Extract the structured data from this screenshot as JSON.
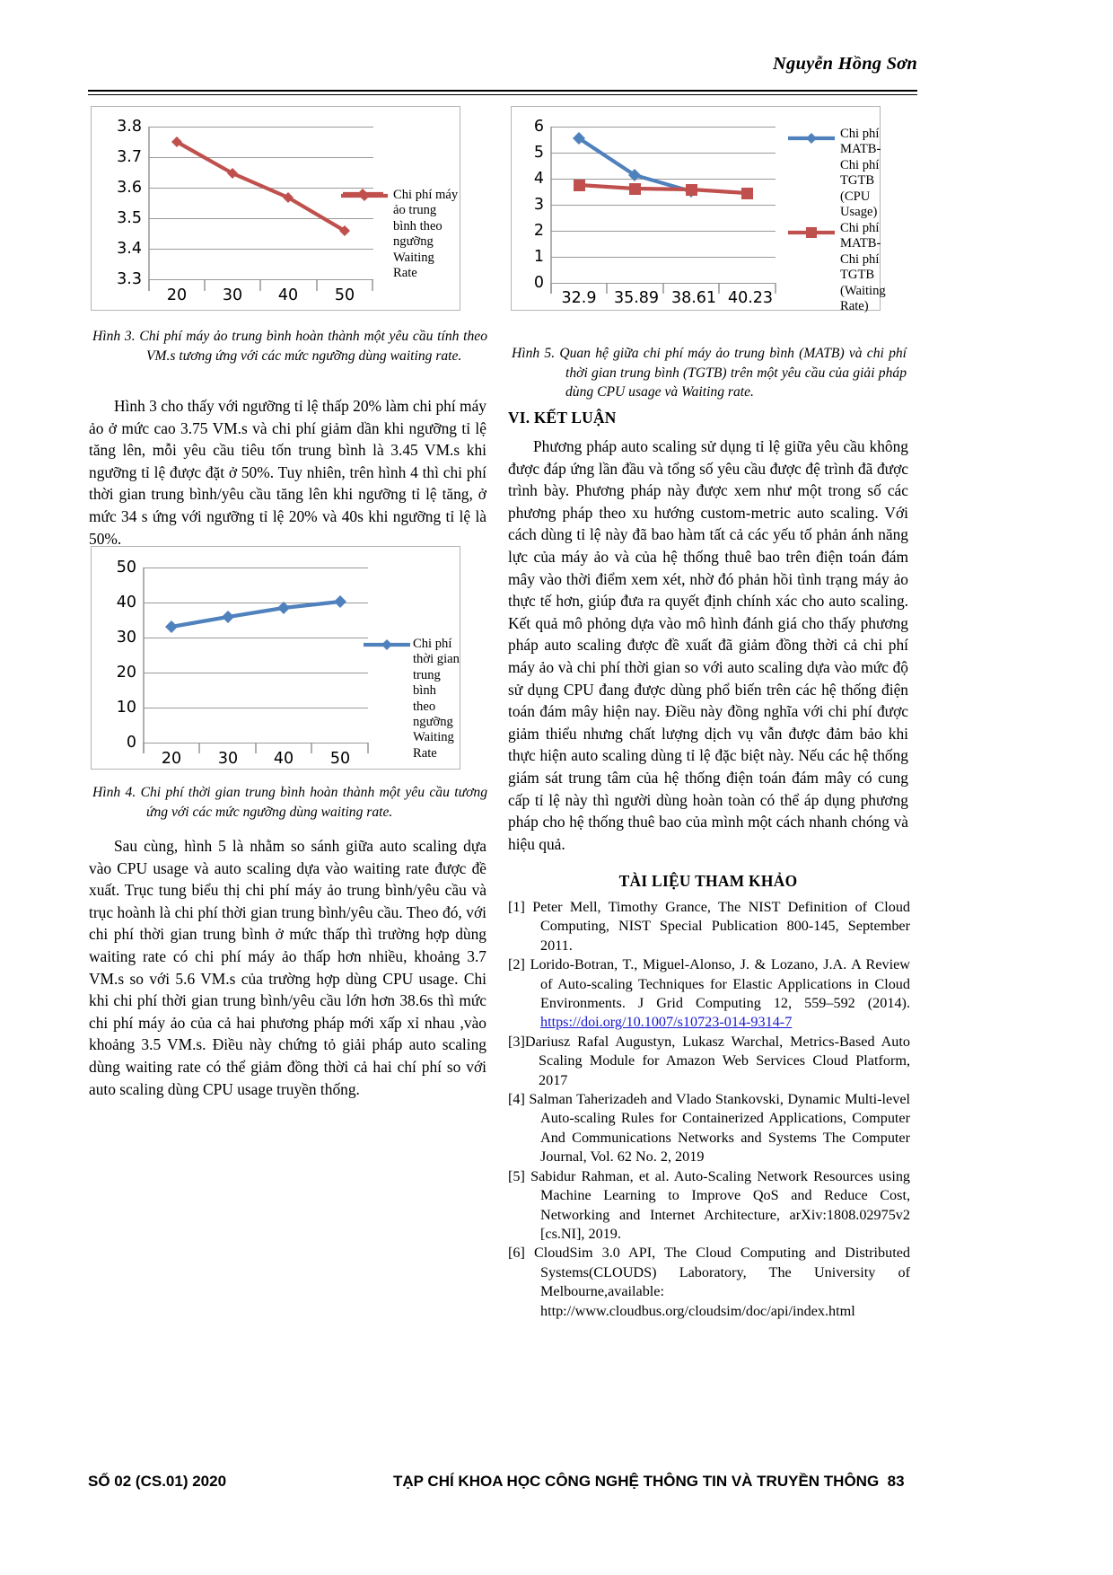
{
  "header": {
    "author": "Nguyễn Hồng Sơn"
  },
  "figure3": {
    "caption_label": "Hình 3.",
    "caption_text": "Chi phí máy ảo trung bình hoàn thành một yêu cầu tính theo VM.s tương ứng với các mức ngưỡng dùng waiting rate.",
    "legend": "Chi phí máy ảo trung bình theo ngưỡng Waiting Rate"
  },
  "figure4": {
    "caption_label": "Hình 4.",
    "caption_text": "Chi phí thời gian trung bình hoàn thành một yêu cầu tương ứng với các mức ngưỡng dùng waiting rate.",
    "legend": "Chi phí thời gian trung bình theo ngưỡng Waiting Rate"
  },
  "figure5": {
    "caption_label": "Hình 5.",
    "caption_text": "Quan hệ giữa chi phí máy ảo trung bình (MATB) và chi phí thời gian trung bình (TGTB) trên một yêu cầu của giải pháp dùng CPU usage và Waiting rate.",
    "legend1": "Chi phí MATB-Chi phí TGTB (CPU Usage)",
    "legend2": "Chi phí MATB-Chi phí TGTB (Waiting Rate)"
  },
  "chart_data": [
    {
      "id": "hinh3",
      "type": "line",
      "title": "",
      "xlabel": "",
      "ylabel": "",
      "categories": [
        "20",
        "30",
        "40",
        "50"
      ],
      "series": [
        {
          "name": "Chi phí máy ảo trung bình theo ngưỡng Waiting Rate",
          "color": "#C0504D",
          "marker": "diamond",
          "values": [
            3.75,
            3.645,
            3.565,
            3.455
          ]
        }
      ],
      "yticks": [
        "3.3",
        "3.4",
        "3.5",
        "3.6",
        "3.7",
        "3.8"
      ],
      "ylim": [
        3.3,
        3.8
      ],
      "grid": true,
      "legend_position": "right"
    },
    {
      "id": "hinh4",
      "type": "line",
      "title": "",
      "xlabel": "",
      "ylabel": "",
      "categories": [
        "20",
        "30",
        "40",
        "50"
      ],
      "series": [
        {
          "name": "Chi phí thời gian trung bình theo ngưỡng Waiting Rate",
          "color": "#4F81BD",
          "marker": "diamond",
          "values": [
            33,
            35.8,
            38.5,
            40.2
          ]
        }
      ],
      "yticks": [
        "0",
        "10",
        "20",
        "30",
        "40",
        "50"
      ],
      "ylim": [
        0,
        50
      ],
      "grid": true,
      "legend_position": "right"
    },
    {
      "id": "hinh5",
      "type": "line",
      "title": "",
      "xlabel": "",
      "ylabel": "",
      "categories": [
        "32.9",
        "35.89",
        "38.61",
        "40.23"
      ],
      "series": [
        {
          "name": "Chi phí MATB-Chi phí TGTB (CPU Usage)",
          "color": "#4F81BD",
          "marker": "diamond",
          "values": [
            5.55,
            4.15,
            3.52,
            null
          ]
        },
        {
          "name": "Chi phí MATB-Chi phí TGTB (Waiting Rate)",
          "color": "#C0504D",
          "marker": "square",
          "values": [
            3.75,
            3.63,
            3.57,
            3.45
          ]
        }
      ],
      "yticks": [
        "0",
        "1",
        "2",
        "3",
        "4",
        "5",
        "6"
      ],
      "ylim": [
        0,
        6
      ],
      "grid": true,
      "legend_position": "right"
    }
  ],
  "left_column": {
    "para1": "Hình 3 cho thấy với ngưỡng tỉ lệ thấp 20% làm chi phí máy ảo ở mức cao 3.75 VM.s và chi phí giảm dần khi ngưỡng tỉ lệ tăng lên, mỗi yêu cầu tiêu tốn trung bình là 3.45 VM.s khi ngưỡng tỉ lệ được đặt ở 50%. Tuy nhiên, trên hình 4 thì chi phí thời gian trung bình/yêu cầu tăng lên khi ngưỡng tỉ lệ tăng, ở mức 34 s ứng với ngưỡng tỉ lệ 20% và 40s khi ngưỡng tỉ lệ là 50%.",
    "para2": "Sau cùng, hình 5 là nhằm so sánh giữa auto scaling dựa vào CPU usage và auto scaling dựa vào waiting rate được đề xuất. Trục tung biểu thị chi phí máy ảo trung bình/yêu cầu và trục hoành là chi phí thời gian trung bình/yêu cầu. Theo đó, với chi phí thời gian trung bình ở mức thấp thì trường hợp dùng waiting rate có chi phí máy ảo thấp hơn nhiều, khoảng 3.7 VM.s so với 5.6 VM.s của trường hợp dùng CPU usage. Chi khi chi phí thời gian trung bình/yêu cầu lớn hơn 38.6s thì mức chi phí máy ảo của cả hai phương pháp mới xấp xỉ nhau ,vào khoảng 3.5 VM.s. Điều này chứng tỏ giải pháp auto scaling dùng waiting rate có thể giảm đồng thời cả hai chí phí so với auto scaling dùng CPU usage truyền thống."
  },
  "right_column": {
    "section_title": "VI. KẾT LUẬN",
    "para1": "Phương pháp auto scaling sử dụng tỉ lệ giữa yêu cầu không được đáp ứng lần đầu và tổng số yêu cầu được đệ trình đã được trình bày. Phương pháp này được xem như một trong số các phương pháp theo xu hướng custom-metric auto scaling. Với cách dùng tỉ lệ này đã bao hàm tất cả các yếu tố phản ánh năng lực của máy ảo và của hệ thống thuê bao trên điện toán đám mây vào thời điểm xem xét, nhờ đó phản hồi tình trạng máy ảo thực tế hơn, giúp đưa ra quyết định chính xác cho auto scaling. Kết quả mô phỏng dựa vào mô hình đánh giá cho thấy phương pháp auto scaling được đề xuất đã giảm đồng thời cả chi phí máy ảo và chi phí thời gian so với auto scaling dựa vào mức độ sử dụng CPU đang được dùng phổ biến trên các hệ thống điện toán đám mây hiện nay. Điều này đồng nghĩa với chi phí được giảm thiểu nhưng chất lượng dịch vụ vẫn được đảm bảo khi thực hiện auto scaling dùng tỉ lệ đặc biệt này. Nếu các hệ thống giám sát trung tâm của hệ thống điện toán đám mây có cung cấp tỉ lệ này thì người dùng hoàn toàn có thể áp dụng phương pháp cho hệ thống thuê bao của mình một cách nhanh chóng và hiệu quả.",
    "refs_title": "TÀI LIỆU THAM KHẢO"
  },
  "references": [
    {
      "num": "[1]",
      "text": "Peter Mell, Timothy Grance, The NIST Definition of Cloud Computing, NIST Special Publication 800-145, September 2011."
    },
    {
      "num": "[2]",
      "pre": "Lorido-Botran, T., Miguel-Alonso, J. & Lozano, J.A. A Review of Auto-scaling Techniques for Elastic Applications in Cloud Environments. J Grid Computing 12, 559–592 (2014). ",
      "link": "https://doi.org/10.1007/s10723-014-9314-7"
    },
    {
      "num": "[3]",
      "text": "Dariusz Rafal Augustyn, Lukasz Warchal, Metrics-Based Auto Scaling Module for Amazon Web Services Cloud Platform, 2017",
      "tight": true
    },
    {
      "num": "[4]",
      "text": "Salman Taherizadeh and Vlado Stankovski, Dynamic Multi-level Auto-scaling Rules for Containerized Applications, Computer And Communications Networks and Systems The Computer Journal, Vol. 62 No. 2, 2019"
    },
    {
      "num": "[5]",
      "text": "Sabidur Rahman, et al. Auto-Scaling Network Resources using Machine Learning to Improve QoS and Reduce Cost, Networking and Internet Architecture, arXiv:1808.02975v2  [cs.NI], 2019."
    },
    {
      "num": "[6]",
      "text": "CloudSim 3.0 API, The Cloud Computing and Distributed Systems(CLOUDS) Laboratory, The University of Melbourne,available:",
      "url": "http://www.cloudbus.org/cloudsim/doc/api/index.html"
    }
  ],
  "footer": {
    "left": "SỐ 02 (CS.01) 2020",
    "center": "TẠP CHÍ KHOA HỌC CÔNG NGHỆ THÔNG TIN VÀ TRUYỀN THÔNG",
    "page": "83"
  }
}
